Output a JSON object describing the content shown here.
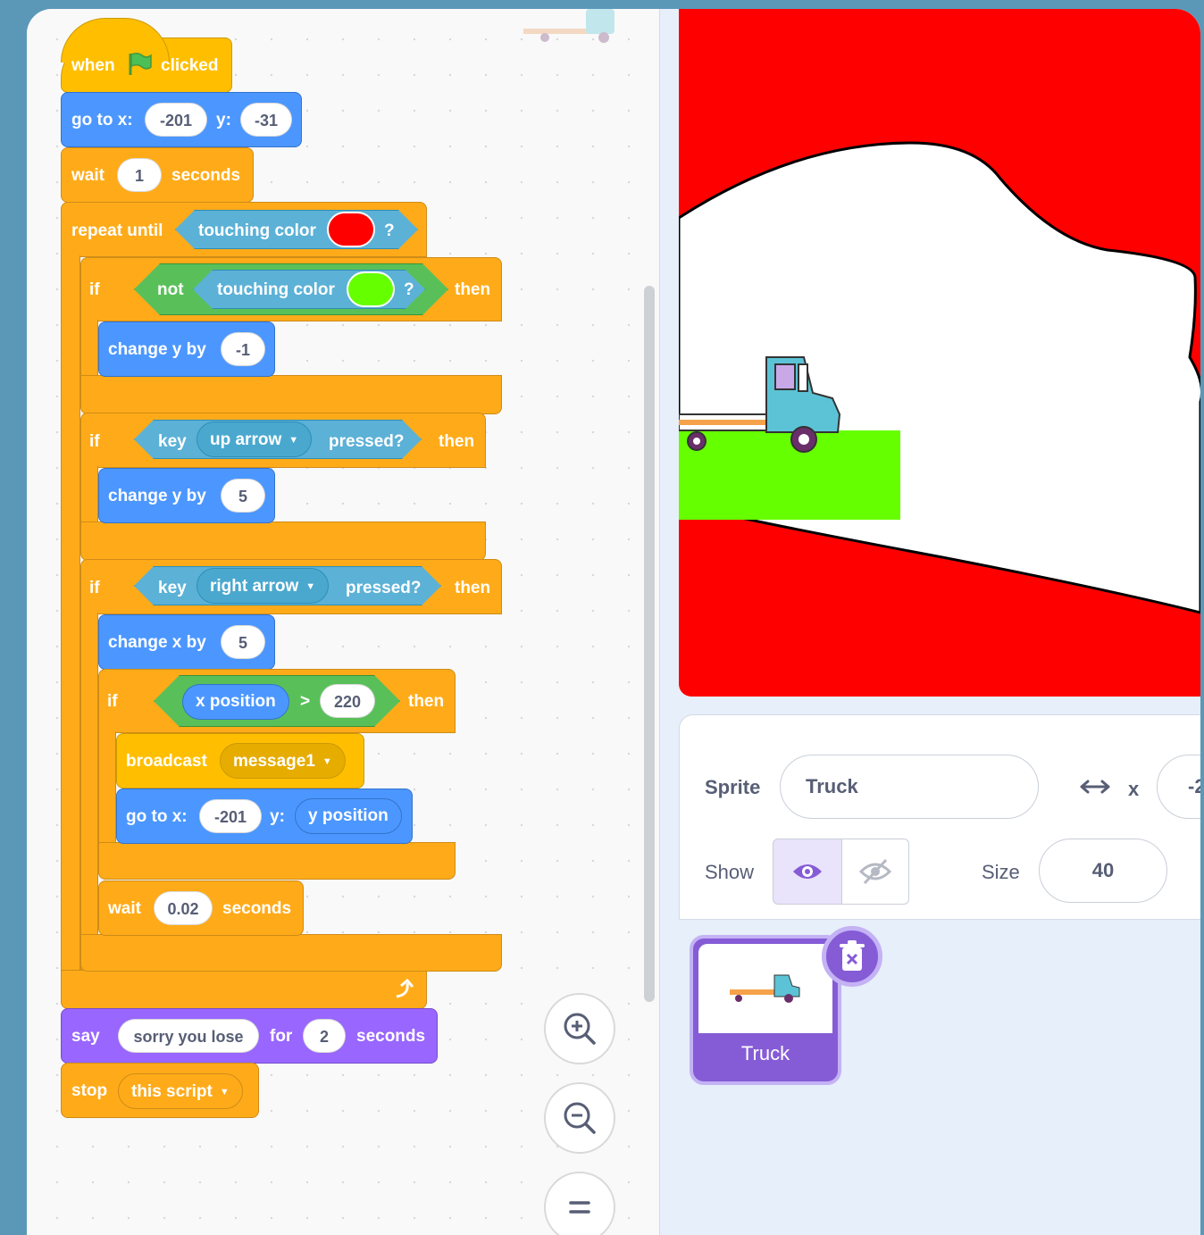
{
  "script": {
    "hat": {
      "when": "when",
      "clicked": "clicked"
    },
    "goto1": {
      "label": "go to x:",
      "x": "-201",
      "ylabel": "y:",
      "y": "-31"
    },
    "wait1": {
      "label": "wait",
      "value": "1",
      "unit": "seconds"
    },
    "repeat": {
      "label": "repeat until",
      "condition": "touching color",
      "q": "?",
      "color": "#ff0000"
    },
    "if1": {
      "label": "if",
      "not": "not",
      "condition": "touching color",
      "q": "?",
      "color": "#66ff00",
      "then": "then"
    },
    "change1": {
      "label": "change y by",
      "value": "-1"
    },
    "if2": {
      "label": "if",
      "key": "key",
      "option": "up arrow",
      "pressed": "pressed?",
      "then": "then"
    },
    "change2": {
      "label": "change y by",
      "value": "5"
    },
    "if3": {
      "label": "if",
      "key": "key",
      "option": "right arrow",
      "pressed": "pressed?",
      "then": "then"
    },
    "change3": {
      "label": "change x by",
      "value": "5"
    },
    "if4": {
      "label": "if",
      "reporter": "x position",
      "op": ">",
      "value": "220",
      "then": "then"
    },
    "broadcast": {
      "label": "broadcast",
      "option": "message1"
    },
    "goto2": {
      "label": "go to x:",
      "x": "-201",
      "ylabel": "y:",
      "y": "y position"
    },
    "wait2": {
      "label": "wait",
      "value": "0.02",
      "unit": "seconds"
    },
    "say": {
      "label": "say",
      "text": "sorry you lose",
      "for": "for",
      "secs": "2",
      "unit": "seconds"
    },
    "stop": {
      "label": "stop",
      "option": "this script"
    }
  },
  "zoom_controls": [
    "zoom-in-icon",
    "zoom-out-icon",
    "reset-zoom-icon"
  ],
  "colors": {
    "events": "#ffbf00",
    "motion": "#4c97ff",
    "control": "#ffab19",
    "sensing": "#5cb1d6",
    "operators": "#59c059",
    "looks": "#9966ff",
    "stage_red": "#ff0000",
    "stage_green": "#66ff00"
  },
  "sprite_info": {
    "sprite_label": "Sprite",
    "sprite_name": "Truck",
    "x_label": "x",
    "x_value": "-2",
    "show_label": "Show",
    "size_label": "Size",
    "size_value": "40"
  },
  "sprite_list": [
    {
      "name": "Truck",
      "selected": true
    }
  ]
}
